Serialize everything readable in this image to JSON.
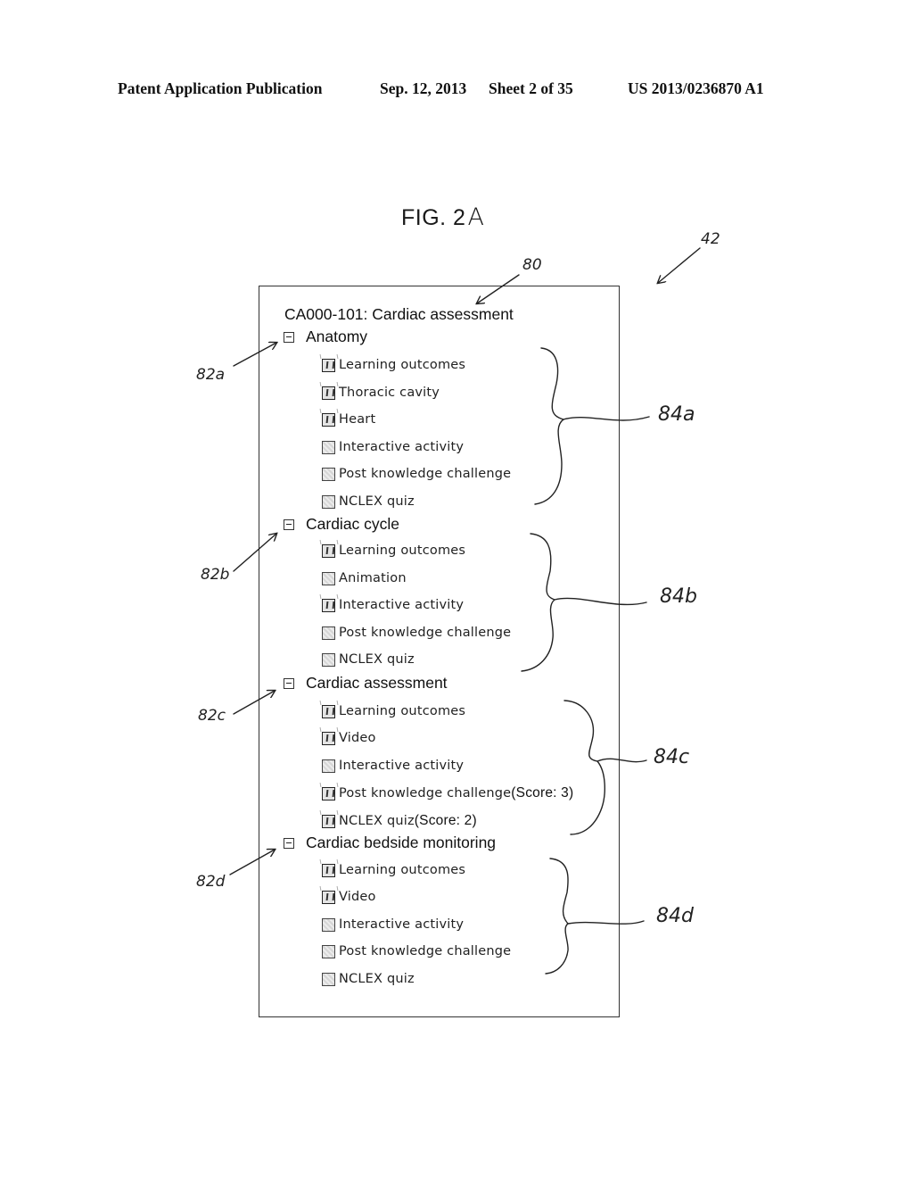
{
  "header": {
    "publication": "Patent Application Publication",
    "date": "Sep. 12, 2013",
    "sheet": "Sheet 2 of 35",
    "number": "US 2013/0236870 A1"
  },
  "figure": {
    "label": "FIG. 2",
    "suffix": "A"
  },
  "annotations": {
    "ref_42": "42",
    "ref_80": "80",
    "ref_82a": "82a",
    "ref_82b": "82b",
    "ref_82c": "82c",
    "ref_82d": "82d",
    "ref_84a": "84a",
    "ref_84b": "84b",
    "ref_84c": "84c",
    "ref_84d": "84d"
  },
  "course": {
    "title": "CA000-101: Cardiac assessment"
  },
  "sections": [
    {
      "title": "Anatomy",
      "collapse_icon": "minus-box-icon",
      "items": [
        {
          "label": "Learning outcomes",
          "checked": true
        },
        {
          "label": "Thoracic cavity",
          "checked": true
        },
        {
          "label": "Heart",
          "checked": true
        },
        {
          "label": "Interactive activity",
          "checked": false
        },
        {
          "label": "Post knowledge challenge",
          "checked": false
        },
        {
          "label": "NCLEX quiz",
          "checked": false
        }
      ]
    },
    {
      "title": "Cardiac cycle",
      "collapse_icon": "minus-box-icon",
      "items": [
        {
          "label": "Learning outcomes",
          "checked": true
        },
        {
          "label": "Animation",
          "checked": false
        },
        {
          "label": "Interactive activity",
          "checked": true
        },
        {
          "label": "Post knowledge challenge",
          "checked": false
        },
        {
          "label": "NCLEX quiz",
          "checked": false
        }
      ]
    },
    {
      "title": "Cardiac assessment",
      "collapse_icon": "minus-box-icon",
      "items": [
        {
          "label": "Learning outcomes",
          "checked": true
        },
        {
          "label": "Video",
          "checked": true
        },
        {
          "label": "Interactive activity",
          "checked": false
        },
        {
          "label": "Post knowledge challenge",
          "checked": true,
          "score": "(Score: 3)"
        },
        {
          "label": "NCLEX quiz",
          "checked": true,
          "score": "(Score: 2)"
        }
      ]
    },
    {
      "title": "Cardiac bedside monitoring",
      "collapse_icon": "minus-box-icon",
      "items": [
        {
          "label": "Learning outcomes",
          "checked": true
        },
        {
          "label": "Video",
          "checked": true
        },
        {
          "label": "Interactive activity",
          "checked": false
        },
        {
          "label": "Post knowledge challenge",
          "checked": false
        },
        {
          "label": "NCLEX quiz",
          "checked": false
        }
      ]
    }
  ]
}
